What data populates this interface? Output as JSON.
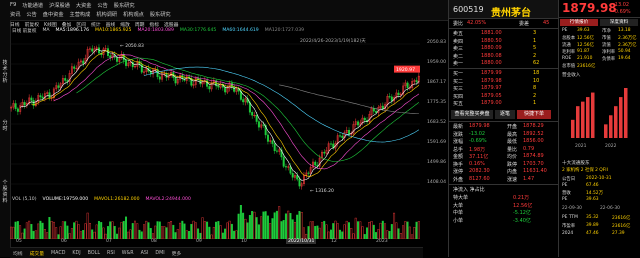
{
  "menu": {
    "row1": [
      "F9",
      "功能通道",
      "沪深股通",
      "大资金",
      "公告",
      "股东研究"
    ],
    "row2": [
      "资讯",
      "公告",
      "盘中资金",
      "主营构成",
      "机构调研",
      "机构观点",
      "股东研究"
    ],
    "window_controls": [
      "—",
      "□",
      "✕"
    ]
  },
  "sidetabs": [
    "技术分析",
    "分时",
    "个股资料"
  ],
  "toolbar": [
    "日线",
    "前复权",
    "K线图",
    "叠加",
    "区间",
    "统计",
    "画线",
    "缩放",
    "周期",
    "指标",
    "选股器"
  ],
  "ma_legend": {
    "label": "日线 前复权",
    "items": [
      {
        "text": "MA",
        "color": "#cfcfcf"
      },
      {
        "text": "MA5:1896.176",
        "color": "#ffffff"
      },
      {
        "text": "MA10:1865.925",
        "color": "#ffd200"
      },
      {
        "text": "MA20:1803.089",
        "color": "#ff4fd8"
      },
      {
        "text": "MA30:1776.645",
        "color": "#1ecc3c"
      },
      {
        "text": "MA60:1644.619",
        "color": "#4fd6ff"
      },
      {
        "text": "MA120:1727.039",
        "color": "#888888"
      }
    ],
    "date_range": "2022/4/26-2023/1/19(182)天"
  },
  "price_annotations": {
    "high": "2050.83",
    "low": "1316.20",
    "last": "1920.97"
  },
  "right_axis": [
    "2050.83",
    "1959.00",
    "1867.17",
    "1775.35",
    "1683.52",
    "1591.69",
    "1499.86",
    "1408.04"
  ],
  "vol_legend": [
    {
      "text": "VOL (5,10)",
      "color": "#cfcfcf"
    },
    {
      "text": "VOLUME:19759.000",
      "color": "#ffffff"
    },
    {
      "text": "MAVOL1:26182.000",
      "color": "#ffd200"
    },
    {
      "text": "MAVOL2:24944.000",
      "color": "#ff4fd8"
    }
  ],
  "month_labels": [
    "05",
    "06",
    "07",
    "08",
    "09",
    "10",
    "2022/10/31",
    "12",
    "2023"
  ],
  "bottom_tabs": [
    "均线",
    "成交量",
    "MACD",
    "KDJ",
    "BOLL",
    "RSI",
    "W&R",
    "ASI",
    "DMI",
    "更多"
  ],
  "quote": {
    "code": "600519",
    "name": "贵州茅台",
    "wei_bi": {
      "label": "委比",
      "value": "42.05%",
      "label2": "委差",
      "value2": "45"
    },
    "asks": [
      {
        "label": "卖五",
        "price": "1881.00",
        "vol": "3"
      },
      {
        "label": "卖四",
        "price": "1880.50",
        "vol": "1"
      },
      {
        "label": "卖三",
        "price": "1880.09",
        "vol": "5"
      },
      {
        "label": "卖二",
        "price": "1880.08",
        "vol": "2"
      },
      {
        "label": "卖一",
        "price": "1880.00",
        "vol": "62"
      }
    ],
    "bids": [
      {
        "label": "买一",
        "price": "1879.99",
        "vol": "18"
      },
      {
        "label": "买二",
        "price": "1879.98",
        "vol": "10"
      },
      {
        "label": "买三",
        "price": "1879.97",
        "vol": "8"
      },
      {
        "label": "买四",
        "price": "1879.05",
        "vol": "2"
      },
      {
        "label": "买五",
        "price": "1879.00",
        "vol": "1"
      }
    ],
    "buttons": [
      "查看完整买卖盘",
      "逐笔",
      "快捷下单"
    ],
    "stats_left": [
      {
        "label": "最新",
        "value": "1879.98"
      },
      {
        "label": "涨跌",
        "value": "-13.02"
      },
      {
        "label": "涨幅",
        "value": "-0.69%"
      },
      {
        "label": "总手",
        "value": "1.98万"
      },
      {
        "label": "金额",
        "value": "37.11亿"
      },
      {
        "label": "换手",
        "value": "0.16%"
      },
      {
        "label": "涨停",
        "value": "2082.30"
      },
      {
        "label": "外盘",
        "value": "8127.60"
      }
    ],
    "stats_right": [
      {
        "label": "开盘",
        "value": "1878.29"
      },
      {
        "label": "最高",
        "value": "1892.52"
      },
      {
        "label": "最低",
        "value": "1856.00"
      },
      {
        "label": "量比",
        "value": "0.79"
      },
      {
        "label": "均价",
        "value": "1874.89"
      },
      {
        "label": "跌停",
        "value": "1703.70"
      },
      {
        "label": "内盘",
        "value": "11631.40"
      },
      {
        "label": "涨速",
        "value": "1.47"
      }
    ],
    "flow": {
      "header": "净流入 净占比",
      "rows": [
        {
          "label": "特大单",
          "v": "0.21万"
        },
        {
          "label": "大单",
          "v": "12.56亿"
        },
        {
          "label": "中单",
          "v": "-5.12亿"
        },
        {
          "label": "小单",
          "v": "-3.40亿"
        }
      ]
    }
  },
  "right": {
    "price": "1879.98",
    "change": "-13.02",
    "pct": "-0.69%",
    "tabs": [
      "行情报价",
      "深度资料"
    ],
    "kv": [
      {
        "k": "PE",
        "v": "39.63",
        "k2": "市净",
        "v2": "13.18"
      },
      {
        "k": "总股本",
        "v": "12.56亿",
        "k2": "市值",
        "v2": "2.36万亿"
      },
      {
        "k": "流通",
        "v": "12.56亿",
        "k2": "流值",
        "v2": "2.36万亿"
      },
      {
        "k": "毛利率",
        "v": "91.87",
        "k2": "净利率",
        "v2": "50.94"
      },
      {
        "k": "ROE",
        "v": "21.910",
        "k2": "负债率",
        "v2": "19.64"
      },
      {
        "k": "总市值",
        "v": "23616亿",
        "k2": "",
        "v2": ""
      }
    ],
    "bar_chart": {
      "title": "营业收入",
      "years": [
        "2021",
        "2022"
      ],
      "values": [
        4,
        7,
        8,
        9,
        10,
        3,
        5,
        7,
        9,
        11
      ]
    },
    "holders": {
      "title": "十大流通股东",
      "summary": "2 家机构 2 社保 2 QFII",
      "columns": [
        "",
        "社保",
        "QFII"
      ],
      "rows": [
        {
          "k": "公告日",
          "v": "2022-10-31"
        },
        {
          "k": "PE",
          "v": "67.46"
        },
        {
          "k": "营收",
          "v": "14.52万"
        },
        {
          "k": "PE",
          "v": "39.63"
        }
      ],
      "quarters": [
        "22-09-30",
        "22-06-30"
      ],
      "bottom": [
        {
          "k": "PE TTM",
          "v": "35.32",
          "v2": "23616亿"
        },
        {
          "k": "市盈率",
          "v": "39.89",
          "v2": "23616亿"
        },
        {
          "k": "2024",
          "v": "47.46",
          "v2": "27.39"
        }
      ]
    }
  },
  "colors": {
    "up": "#ff3b3b",
    "down": "#1ecc3c",
    "accent": "#ffd200",
    "bg": "#000000"
  }
}
